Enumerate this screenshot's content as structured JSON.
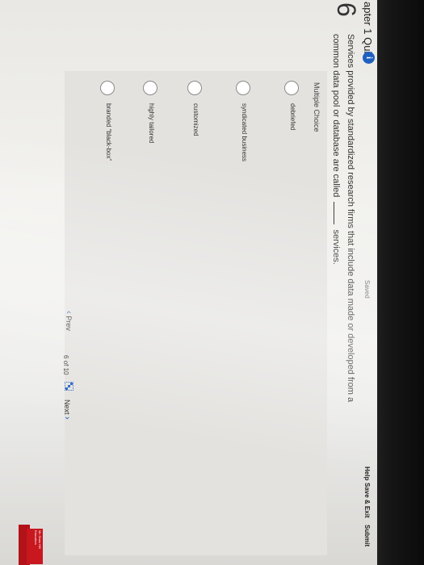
{
  "header": {
    "quiz_title": "apter 1 Quiz",
    "info_icon": "info-icon",
    "saved": "Saved",
    "help": "Help",
    "save_exit": "Save & Exit",
    "submit": "Submit"
  },
  "question": {
    "number": "6",
    "text_before": "Services provided by standardized research firms that include data made or developed from a common data pool or database are called",
    "text_after": "services."
  },
  "answers": {
    "type_label": "Multiple Choice",
    "options": [
      "debriefed",
      "syndicated business",
      "customized",
      "highly tailored",
      "branded “black-box”"
    ]
  },
  "navigation": {
    "prev": "Prev",
    "page_current": "6",
    "page_of": "of",
    "page_total": "10",
    "next": "Next"
  },
  "logo": {
    "text": "Mc Graw Hill Education"
  },
  "colors": {
    "accent": "#1f5fbf",
    "logo_red": "#c8171e"
  }
}
